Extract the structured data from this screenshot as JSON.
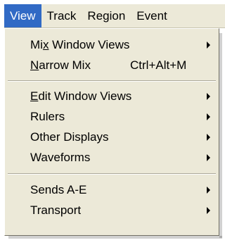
{
  "menubar": {
    "items": [
      {
        "label": "View"
      },
      {
        "label": "Track"
      },
      {
        "label": "Region"
      },
      {
        "label": "Event"
      }
    ]
  },
  "menu": {
    "items": [
      {
        "pre": "Mi",
        "ul": "x",
        "post": " Window Views",
        "submenu": true
      },
      {
        "pre": "",
        "ul": "N",
        "post": "arrow Mix",
        "shortcut": "Ctrl+Alt+M"
      },
      {
        "pre": "",
        "ul": "E",
        "post": "dit Window Views",
        "submenu": true
      },
      {
        "label": "Rulers",
        "submenu": true
      },
      {
        "label": "Other Displays",
        "submenu": true
      },
      {
        "label": "Waveforms",
        "submenu": true
      },
      {
        "label": "Sends A-E",
        "submenu": true
      },
      {
        "label": "Transport",
        "submenu": true
      }
    ]
  }
}
